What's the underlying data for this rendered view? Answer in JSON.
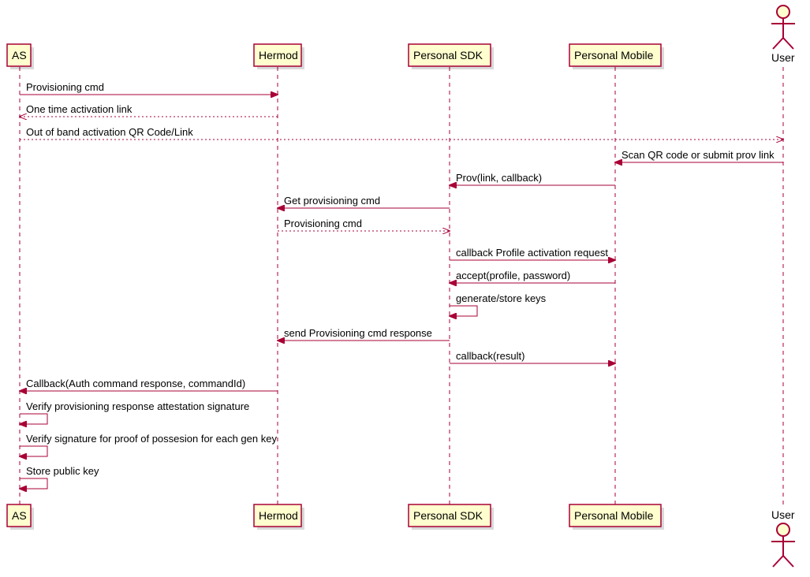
{
  "participants": {
    "as": "AS",
    "hermod": "Hermod",
    "sdk": "Personal SDK",
    "mobile": "Personal Mobile",
    "user": "User"
  },
  "messages": {
    "m1": "Provisioning cmd",
    "m2": "One time activation link",
    "m3": "Out of band activation QR Code/Link",
    "m4": "Scan QR code or submit prov link",
    "m5": "Prov(link, callback)",
    "m6": "Get provisioning cmd",
    "m7": "Provisioning cmd",
    "m8": "callback Profile activation request",
    "m9": "accept(profile, password)",
    "m10": "generate/store keys",
    "m11": "send Provisioning cmd response",
    "m12": "callback(result)",
    "m13": "Callback(Auth command response, commandId)",
    "m14": "Verify provisioning response attestation signature",
    "m15": "Verify signature for proof of possesion for each gen key",
    "m16": "Store public key"
  },
  "chart_data": {
    "type": "sequence-diagram",
    "participants": [
      "AS",
      "Hermod",
      "Personal SDK",
      "Personal Mobile",
      "User"
    ],
    "user_is_actor": true,
    "messages": [
      {
        "from": "AS",
        "to": "Hermod",
        "label": "Provisioning cmd",
        "style": "solid"
      },
      {
        "from": "Hermod",
        "to": "AS",
        "label": "One time activation link",
        "style": "dashed"
      },
      {
        "from": "AS",
        "to": "User",
        "label": "Out of band activation QR Code/Link",
        "style": "dashed"
      },
      {
        "from": "User",
        "to": "Personal Mobile",
        "label": "Scan QR code or submit prov link",
        "style": "solid"
      },
      {
        "from": "Personal Mobile",
        "to": "Personal SDK",
        "label": "Prov(link, callback)",
        "style": "solid"
      },
      {
        "from": "Personal SDK",
        "to": "Hermod",
        "label": "Get provisioning cmd",
        "style": "solid"
      },
      {
        "from": "Hermod",
        "to": "Personal SDK",
        "label": "Provisioning cmd",
        "style": "dashed"
      },
      {
        "from": "Personal SDK",
        "to": "Personal Mobile",
        "label": "callback Profile activation request",
        "style": "solid"
      },
      {
        "from": "Personal Mobile",
        "to": "Personal SDK",
        "label": "accept(profile, password)",
        "style": "solid"
      },
      {
        "from": "Personal SDK",
        "to": "Personal SDK",
        "label": "generate/store keys",
        "style": "self"
      },
      {
        "from": "Personal SDK",
        "to": "Hermod",
        "label": "send Provisioning cmd response",
        "style": "solid"
      },
      {
        "from": "Personal SDK",
        "to": "Personal Mobile",
        "label": "callback(result)",
        "style": "solid"
      },
      {
        "from": "Hermod",
        "to": "AS",
        "label": "Callback(Auth command response, commandId)",
        "style": "solid"
      },
      {
        "from": "AS",
        "to": "AS",
        "label": "Verify provisioning response attestation signature",
        "style": "self"
      },
      {
        "from": "AS",
        "to": "AS",
        "label": "Verify signature for proof of possesion for each gen key",
        "style": "self"
      },
      {
        "from": "AS",
        "to": "AS",
        "label": "Store public key",
        "style": "self"
      }
    ]
  }
}
